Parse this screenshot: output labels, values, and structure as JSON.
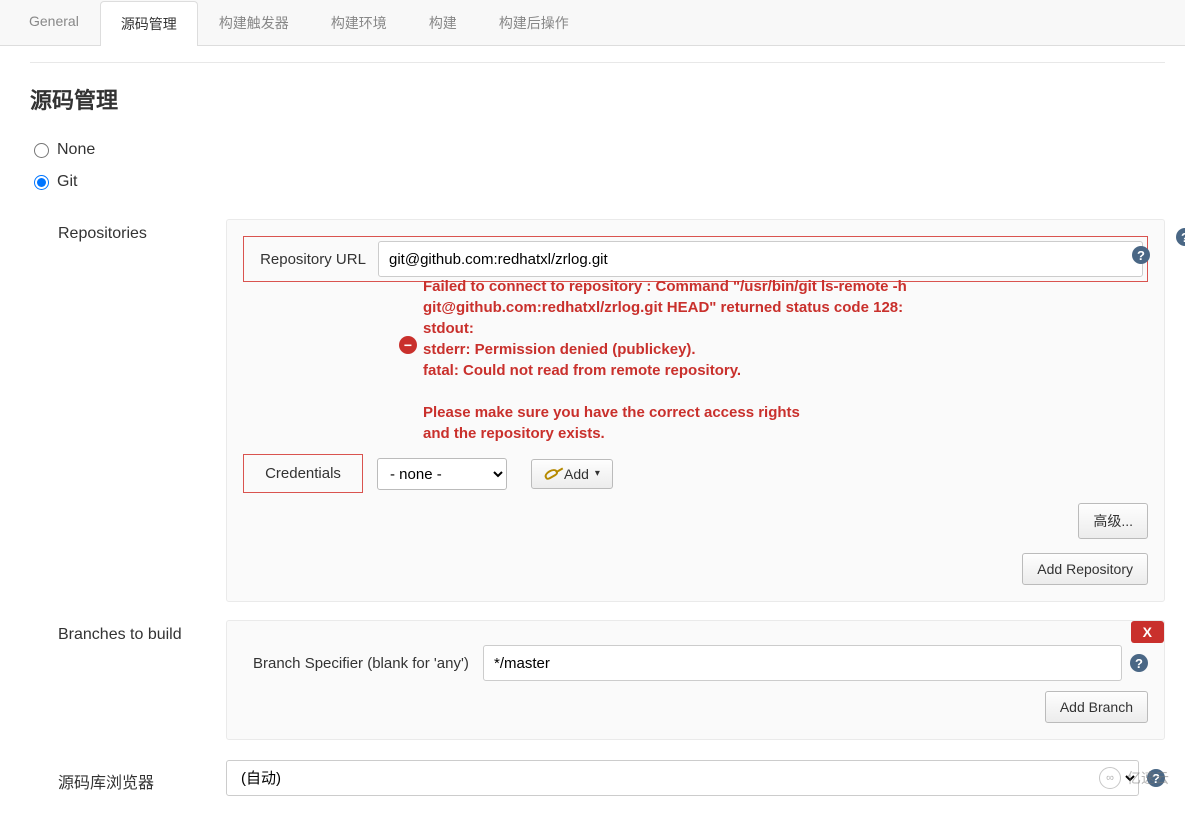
{
  "tabs": {
    "items": [
      "General",
      "源码管理",
      "构建触发器",
      "构建环境",
      "构建",
      "构建后操作"
    ],
    "activeIndex": 1
  },
  "section": {
    "title": "源码管理"
  },
  "scm": {
    "noneLabel": "None",
    "gitLabel": "Git",
    "selected": "git"
  },
  "repositories": {
    "label": "Repositories",
    "repoUrlLabel": "Repository URL",
    "repoUrlValue": "git@github.com:redhatxl/zrlog.git",
    "errorText": "Failed to connect to repository : Command \"/usr/bin/git ls-remote -h\ngit@github.com:redhatxl/zrlog.git HEAD\" returned status code 128:\nstdout:\nstderr: Permission denied (publickey).\nfatal: Could not read from remote repository.\n\nPlease make sure you have the correct access rights\nand the repository exists.",
    "credentialsLabel": "Credentials",
    "credentialsSelected": "- none -",
    "addLabel": "Add",
    "advancedLabel": "高级...",
    "addRepoLabel": "Add Repository"
  },
  "branches": {
    "label": "Branches to build",
    "specifierLabel": "Branch Specifier (blank for 'any')",
    "specifierValue": "*/master",
    "addBranchLabel": "Add Branch",
    "deleteLabel": "X"
  },
  "browser": {
    "label": "源码库浏览器",
    "selected": "(自动)"
  },
  "watermark": "亿速云"
}
